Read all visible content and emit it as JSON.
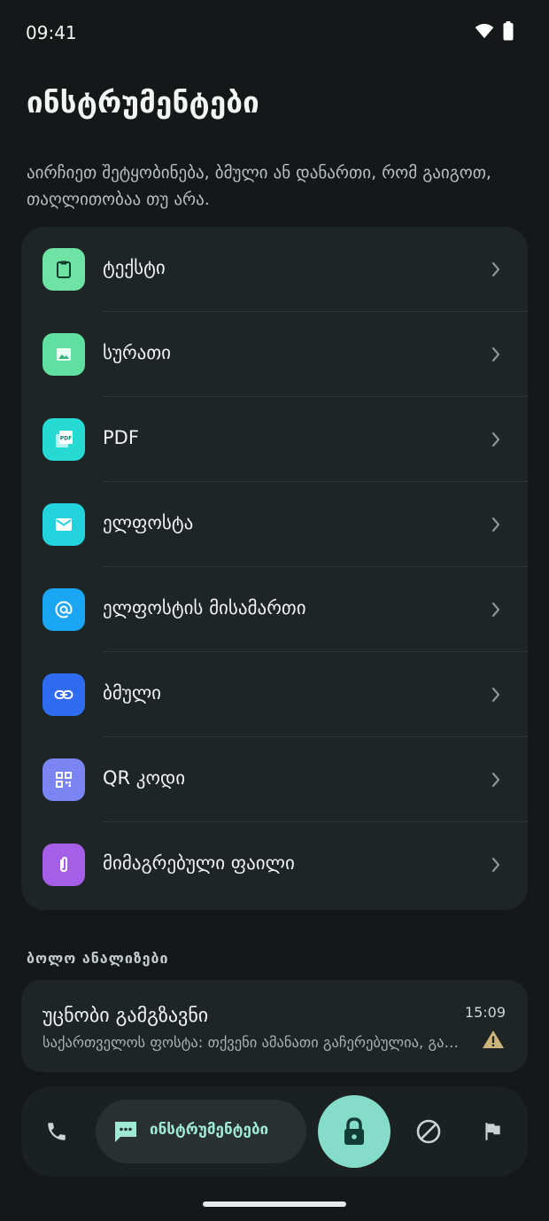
{
  "status": {
    "time": "09:41"
  },
  "header": {
    "title": "ინსტრუმენტები",
    "description": "აირჩიეთ შეტყობინება, ბმული ან დანართი, რომ გაიგოთ, თაღლითობაა თუ არა."
  },
  "tools": [
    {
      "label": "ტექსტი",
      "icon": "clipboard-icon",
      "color": "#6ee3a3"
    },
    {
      "label": "სურათი",
      "icon": "image-icon",
      "color": "#5fe0a0"
    },
    {
      "label": "PDF",
      "icon": "pdf-icon",
      "color": "#27d9d3"
    },
    {
      "label": "ელფოსტა",
      "icon": "mail-icon",
      "color": "#22d3de"
    },
    {
      "label": "ელფოსტის მისამართი",
      "icon": "at-sign-icon",
      "color": "#1aa6f2"
    },
    {
      "label": "ბმული",
      "icon": "link-icon",
      "color": "#2f6bf0"
    },
    {
      "label": "QR კოდი",
      "icon": "qr-code-icon",
      "color": "#7a84f2"
    },
    {
      "label": "მიმაგრებული ფაილი",
      "icon": "paperclip-icon",
      "color": "#a45ee8"
    }
  ],
  "recent": {
    "header": "ბოლო ანალიზები",
    "items": [
      {
        "sender": "უცნობი გამგზავნი",
        "time": "15:09",
        "preview": "საქართველოს ფოსტა: თქვენი ამანათი გაჩერებულია, გადაიხადეთ საბაჟო",
        "status_icon": "warning-icon"
      }
    ]
  },
  "nav": {
    "active_label": "ინსტრუმენტები",
    "items": [
      "phone-icon",
      "chat-icon",
      "lock-icon",
      "block-icon",
      "flag-icon"
    ]
  },
  "colors": {
    "background": "#151818",
    "card": "#1f2424",
    "accent": "#84dcc9",
    "warning": "#cdb57a"
  }
}
